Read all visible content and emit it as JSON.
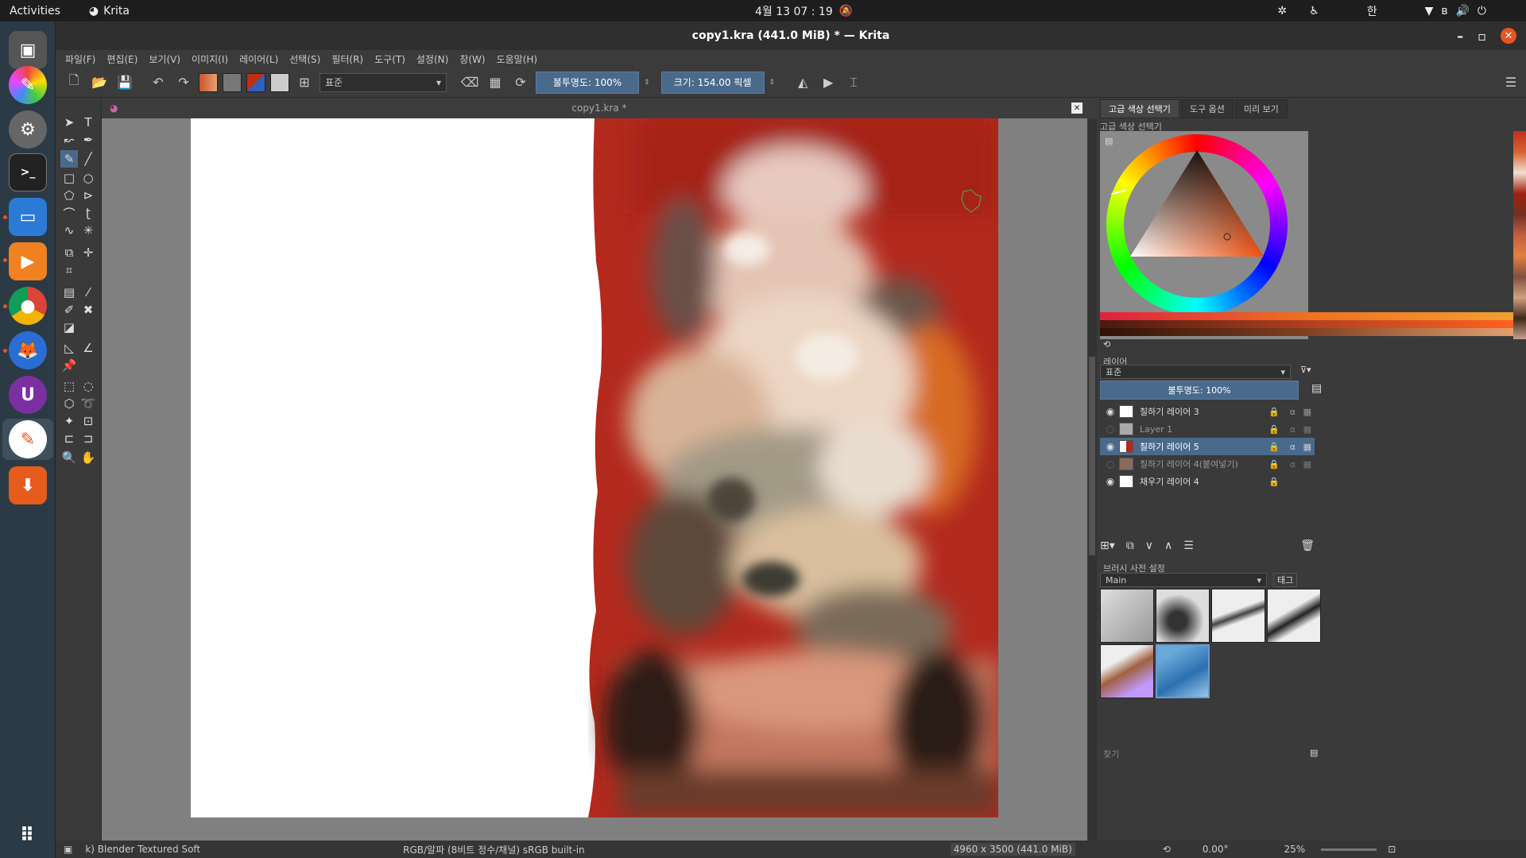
{
  "topbar": {
    "activities": "Activities",
    "app_name": "Krita",
    "datetime": "4월 13  07 : 19",
    "ime": "한"
  },
  "window": {
    "title": "copy1.kra (441.0 MiB)  * — Krita",
    "minimize": "–",
    "maximize": "–",
    "close": "✕"
  },
  "menu": [
    "파일(F)",
    "편집(E)",
    "보기(V)",
    "이미지(I)",
    "레이어(L)",
    "선택(S)",
    "필터(R)",
    "도구(T)",
    "설정(N)",
    "창(W)",
    "도움말(H)"
  ],
  "toolbar": {
    "blend_mode": "표준",
    "opacity_label": "불투명도: 100%",
    "size_label": "크기: 154.00 픽셀"
  },
  "document": {
    "tab_title": "copy1.kra *"
  },
  "dockers": {
    "tabs": [
      "고급 색상 선택기",
      "도구 옵션",
      "미리 보기"
    ],
    "color_selector_title": "고급 색상 선택기",
    "layers_title": "레이어",
    "layers_blend": "표준",
    "layers_opacity": "불투명도:  100%",
    "layers": [
      {
        "name": "칠하기 레이어 3",
        "visible": true,
        "selected": false
      },
      {
        "name": "Layer 1",
        "visible": false,
        "selected": false
      },
      {
        "name": "칠하기 레이어 5",
        "visible": true,
        "selected": true
      },
      {
        "name": "칠하기 레이어 4(붙여넣기)",
        "visible": false,
        "selected": false
      },
      {
        "name": "채우기 레이어 4",
        "visible": true,
        "selected": false
      }
    ],
    "brush_title": "브러시 사전 설정",
    "brush_tag": "Main",
    "brush_tag_btn": "태그",
    "brush_search": "찾기"
  },
  "status": {
    "brush": "k) Blender Textured Soft",
    "color_space": "RGB/알파 (8비트 정수/채널)  sRGB built-in",
    "image_size": "4960 x 3500 (441.0 MiB)",
    "rotation": "0.00°",
    "zoom": "25%"
  },
  "colors": {
    "accent": "#e95420",
    "selection": "#4a6a8c"
  }
}
